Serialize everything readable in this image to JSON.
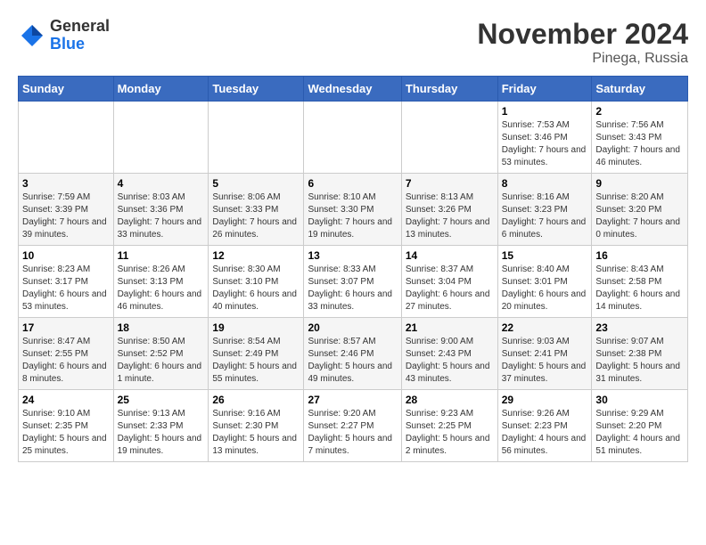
{
  "header": {
    "logo_general": "General",
    "logo_blue": "Blue",
    "month": "November 2024",
    "location": "Pinega, Russia"
  },
  "weekdays": [
    "Sunday",
    "Monday",
    "Tuesday",
    "Wednesday",
    "Thursday",
    "Friday",
    "Saturday"
  ],
  "weeks": [
    [
      {
        "day": "",
        "info": ""
      },
      {
        "day": "",
        "info": ""
      },
      {
        "day": "",
        "info": ""
      },
      {
        "day": "",
        "info": ""
      },
      {
        "day": "",
        "info": ""
      },
      {
        "day": "1",
        "info": "Sunrise: 7:53 AM\nSunset: 3:46 PM\nDaylight: 7 hours\nand 53 minutes."
      },
      {
        "day": "2",
        "info": "Sunrise: 7:56 AM\nSunset: 3:43 PM\nDaylight: 7 hours\nand 46 minutes."
      }
    ],
    [
      {
        "day": "3",
        "info": "Sunrise: 7:59 AM\nSunset: 3:39 PM\nDaylight: 7 hours\nand 39 minutes."
      },
      {
        "day": "4",
        "info": "Sunrise: 8:03 AM\nSunset: 3:36 PM\nDaylight: 7 hours\nand 33 minutes."
      },
      {
        "day": "5",
        "info": "Sunrise: 8:06 AM\nSunset: 3:33 PM\nDaylight: 7 hours\nand 26 minutes."
      },
      {
        "day": "6",
        "info": "Sunrise: 8:10 AM\nSunset: 3:30 PM\nDaylight: 7 hours\nand 19 minutes."
      },
      {
        "day": "7",
        "info": "Sunrise: 8:13 AM\nSunset: 3:26 PM\nDaylight: 7 hours\nand 13 minutes."
      },
      {
        "day": "8",
        "info": "Sunrise: 8:16 AM\nSunset: 3:23 PM\nDaylight: 7 hours\nand 6 minutes."
      },
      {
        "day": "9",
        "info": "Sunrise: 8:20 AM\nSunset: 3:20 PM\nDaylight: 7 hours\nand 0 minutes."
      }
    ],
    [
      {
        "day": "10",
        "info": "Sunrise: 8:23 AM\nSunset: 3:17 PM\nDaylight: 6 hours\nand 53 minutes."
      },
      {
        "day": "11",
        "info": "Sunrise: 8:26 AM\nSunset: 3:13 PM\nDaylight: 6 hours\nand 46 minutes."
      },
      {
        "day": "12",
        "info": "Sunrise: 8:30 AM\nSunset: 3:10 PM\nDaylight: 6 hours\nand 40 minutes."
      },
      {
        "day": "13",
        "info": "Sunrise: 8:33 AM\nSunset: 3:07 PM\nDaylight: 6 hours\nand 33 minutes."
      },
      {
        "day": "14",
        "info": "Sunrise: 8:37 AM\nSunset: 3:04 PM\nDaylight: 6 hours\nand 27 minutes."
      },
      {
        "day": "15",
        "info": "Sunrise: 8:40 AM\nSunset: 3:01 PM\nDaylight: 6 hours\nand 20 minutes."
      },
      {
        "day": "16",
        "info": "Sunrise: 8:43 AM\nSunset: 2:58 PM\nDaylight: 6 hours\nand 14 minutes."
      }
    ],
    [
      {
        "day": "17",
        "info": "Sunrise: 8:47 AM\nSunset: 2:55 PM\nDaylight: 6 hours\nand 8 minutes."
      },
      {
        "day": "18",
        "info": "Sunrise: 8:50 AM\nSunset: 2:52 PM\nDaylight: 6 hours\nand 1 minute."
      },
      {
        "day": "19",
        "info": "Sunrise: 8:54 AM\nSunset: 2:49 PM\nDaylight: 5 hours\nand 55 minutes."
      },
      {
        "day": "20",
        "info": "Sunrise: 8:57 AM\nSunset: 2:46 PM\nDaylight: 5 hours\nand 49 minutes."
      },
      {
        "day": "21",
        "info": "Sunrise: 9:00 AM\nSunset: 2:43 PM\nDaylight: 5 hours\nand 43 minutes."
      },
      {
        "day": "22",
        "info": "Sunrise: 9:03 AM\nSunset: 2:41 PM\nDaylight: 5 hours\nand 37 minutes."
      },
      {
        "day": "23",
        "info": "Sunrise: 9:07 AM\nSunset: 2:38 PM\nDaylight: 5 hours\nand 31 minutes."
      }
    ],
    [
      {
        "day": "24",
        "info": "Sunrise: 9:10 AM\nSunset: 2:35 PM\nDaylight: 5 hours\nand 25 minutes."
      },
      {
        "day": "25",
        "info": "Sunrise: 9:13 AM\nSunset: 2:33 PM\nDaylight: 5 hours\nand 19 minutes."
      },
      {
        "day": "26",
        "info": "Sunrise: 9:16 AM\nSunset: 2:30 PM\nDaylight: 5 hours\nand 13 minutes."
      },
      {
        "day": "27",
        "info": "Sunrise: 9:20 AM\nSunset: 2:27 PM\nDaylight: 5 hours\nand 7 minutes."
      },
      {
        "day": "28",
        "info": "Sunrise: 9:23 AM\nSunset: 2:25 PM\nDaylight: 5 hours\nand 2 minutes."
      },
      {
        "day": "29",
        "info": "Sunrise: 9:26 AM\nSunset: 2:23 PM\nDaylight: 4 hours\nand 56 minutes."
      },
      {
        "day": "30",
        "info": "Sunrise: 9:29 AM\nSunset: 2:20 PM\nDaylight: 4 hours\nand 51 minutes."
      }
    ]
  ]
}
